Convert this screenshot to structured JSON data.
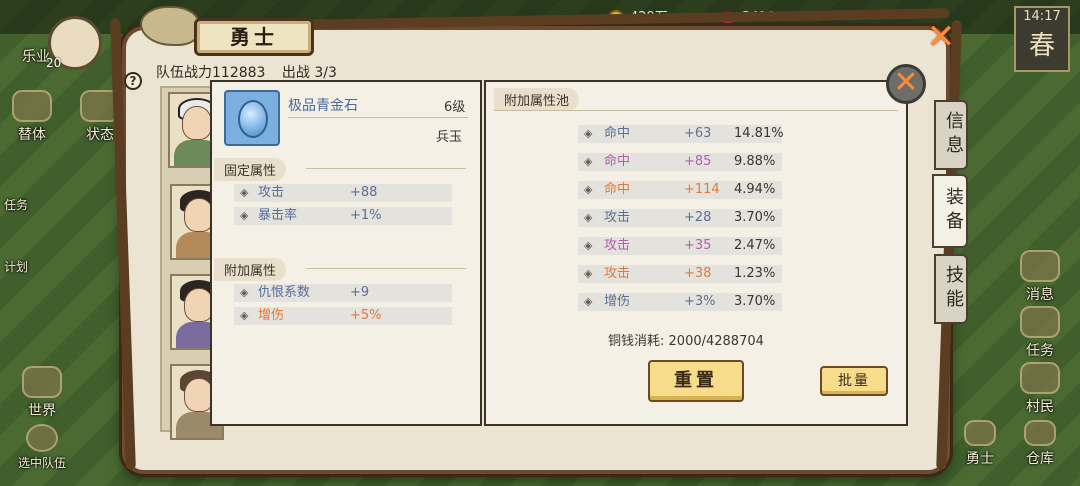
{
  "topbar": {
    "coins": "429万",
    "gems": "3410",
    "time": "14:17",
    "season": "春"
  },
  "left_menu": [
    {
      "label": "乐业"
    },
    {
      "label": "替体"
    },
    {
      "label": "状态"
    },
    {
      "label": "任务"
    },
    {
      "label": "计划"
    },
    {
      "label": "世界"
    },
    {
      "label": "选中队伍"
    }
  ],
  "right_menu": [
    {
      "label": "消息"
    },
    {
      "label": "任务"
    },
    {
      "label": "村民"
    },
    {
      "label": "勇士"
    },
    {
      "label": "仓库"
    }
  ],
  "player": {
    "level": "20"
  },
  "dialog": {
    "title": "勇士",
    "team_power_label": "队伍战力",
    "team_power": "112883",
    "deploy_label": "出战",
    "deploy": "3/3",
    "help": "?",
    "close": "✕"
  },
  "tabs": [
    {
      "label": "信息"
    },
    {
      "label": "装备"
    },
    {
      "label": "技能"
    }
  ],
  "item": {
    "name": "极品青金石",
    "level": "6级",
    "type": "兵玉",
    "fixed_header": "固定属性",
    "fixed_stats": [
      {
        "name": "攻击",
        "value": "+88",
        "color": "#5a6f9a"
      },
      {
        "name": "暴击率",
        "value": "+1%",
        "color": "#5a6f9a"
      }
    ],
    "extra_header": "附加属性",
    "extra_stats": [
      {
        "name": "仇恨系数",
        "value": "+9",
        "color": "#5a6f9a"
      },
      {
        "name": "增伤",
        "value": "+5%",
        "color": "#e07a3a"
      }
    ]
  },
  "pool": {
    "header": "附加属性池",
    "rows": [
      {
        "name": "命中",
        "value": "+63",
        "percent": "14.81%",
        "color": "#5a6f9a"
      },
      {
        "name": "命中",
        "value": "+85",
        "percent": "9.88%",
        "color": "#b25fb0"
      },
      {
        "name": "命中",
        "value": "+114",
        "percent": "4.94%",
        "color": "#e07a3a"
      },
      {
        "name": "攻击",
        "value": "+28",
        "percent": "3.70%",
        "color": "#5a6f9a"
      },
      {
        "name": "攻击",
        "value": "+35",
        "percent": "2.47%",
        "color": "#b25fb0"
      },
      {
        "name": "攻击",
        "value": "+38",
        "percent": "1.23%",
        "color": "#e07a3a"
      },
      {
        "name": "增伤",
        "value": "+3%",
        "percent": "3.70%",
        "color": "#5a6f9a"
      }
    ],
    "cost_label": "铜钱消耗:",
    "cost": "2000/4288704",
    "reset_label": "重置",
    "batch_label": "批量"
  }
}
